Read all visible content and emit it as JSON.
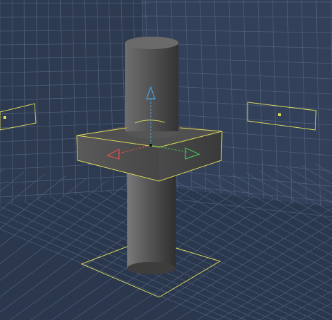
{
  "viewport": {
    "colors": {
      "background": "#2f3c52",
      "grid": "#5b6f8b",
      "selection_outline": "#d8d85a",
      "object_light": "#6b6b6b",
      "object_dark": "#3a3a3a",
      "axis_x": "#e05050",
      "axis_y": "#4aa0e0",
      "axis_z": "#40c060"
    },
    "objects": [
      {
        "name": "vertical-cylinder",
        "selected": true
      },
      {
        "name": "square-block",
        "selected": true
      }
    ],
    "gizmo": {
      "axes": [
        "x-axis-arrow",
        "y-axis-arrow",
        "z-axis-arrow"
      ]
    }
  }
}
